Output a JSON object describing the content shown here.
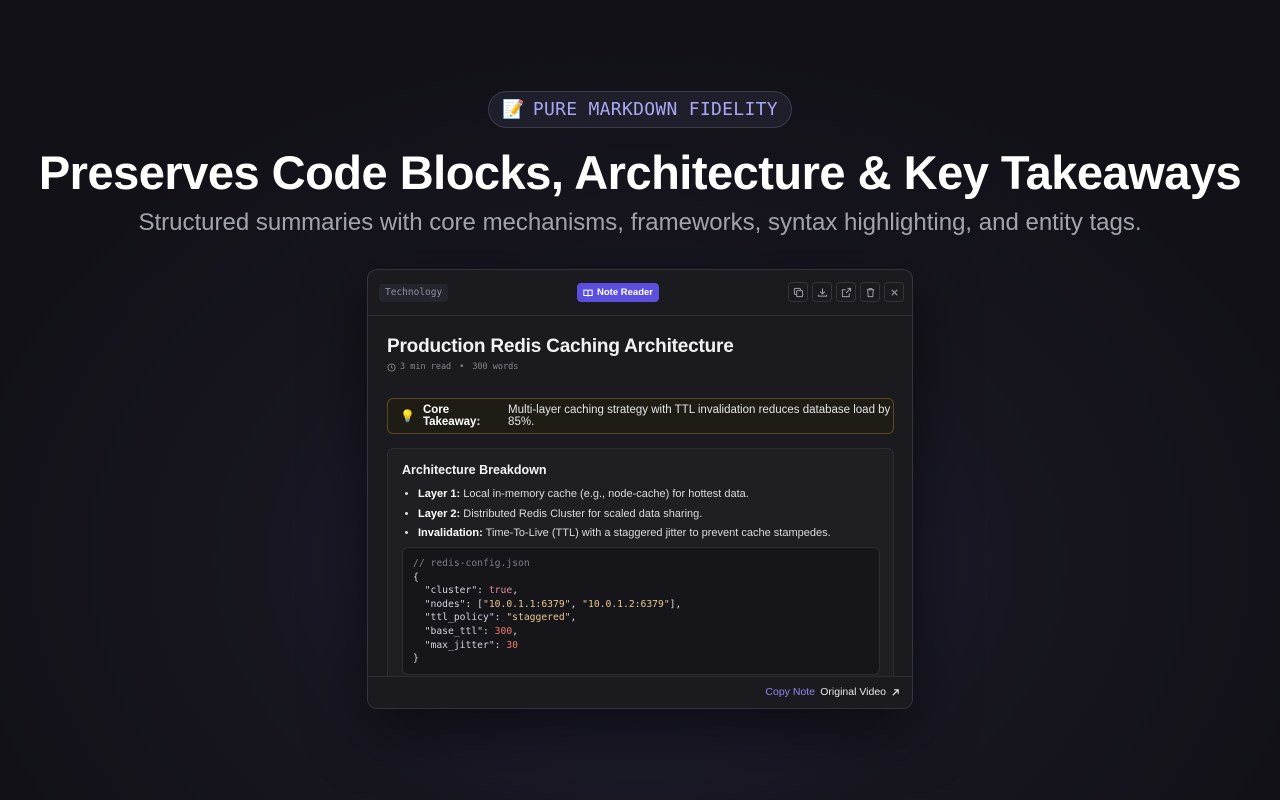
{
  "badge": {
    "emoji": "📝",
    "label": "PURE MARKDOWN FIDELITY"
  },
  "headline": "Preserves Code Blocks, Architecture & Key Takeaways",
  "subheadline": "Structured summaries with core mechanisms, frameworks, syntax highlighting, and entity tags.",
  "reader": {
    "tag": "Technology",
    "mode_button": "Note Reader",
    "toolbar_icons": [
      "copy-icon",
      "download-icon",
      "external-link-icon",
      "trash-icon",
      "close-icon"
    ],
    "title": "Production Redis Caching Architecture",
    "meta": {
      "read_time": "3 min read",
      "separator": "•",
      "word_count": "300 words"
    },
    "takeaway": {
      "label": "Core Takeaway:",
      "text": "Multi-layer caching strategy with TTL invalidation reduces database load by 85%."
    },
    "section": {
      "heading": "Architecture Breakdown",
      "items": [
        {
          "label": "Layer 1:",
          "text": "Local in-memory cache (e.g., node-cache) for hottest data."
        },
        {
          "label": "Layer 2:",
          "text": "Distributed Redis Cluster for scaled data sharing."
        },
        {
          "label": "Invalidation:",
          "text": "Time-To-Live (TTL) with a staggered jitter to prevent cache stampedes."
        }
      ]
    },
    "code": {
      "comment": "// redis-config.json",
      "open": "{",
      "close": "}",
      "cluster_key": "\"cluster\"",
      "cluster_val": "true",
      "nodes_key": "\"nodes\"",
      "node_1": "\"10.0.1.1:6379\"",
      "node_2": "\"10.0.1.2:6379\"",
      "ttl_key": "\"ttl_policy\"",
      "ttl_val": "\"staggered\"",
      "base_key": "\"base_ttl\"",
      "base_val": "300",
      "jitter_key": "\"max_jitter\"",
      "jitter_val": "30"
    },
    "footer": {
      "copy": "Copy Note",
      "video": "Original Video"
    }
  },
  "colors": {
    "accent": "#5b4fe0",
    "badge_text": "#a9a6f3",
    "warning_border": "#5a4a26",
    "bulb": "#e0b54a"
  }
}
